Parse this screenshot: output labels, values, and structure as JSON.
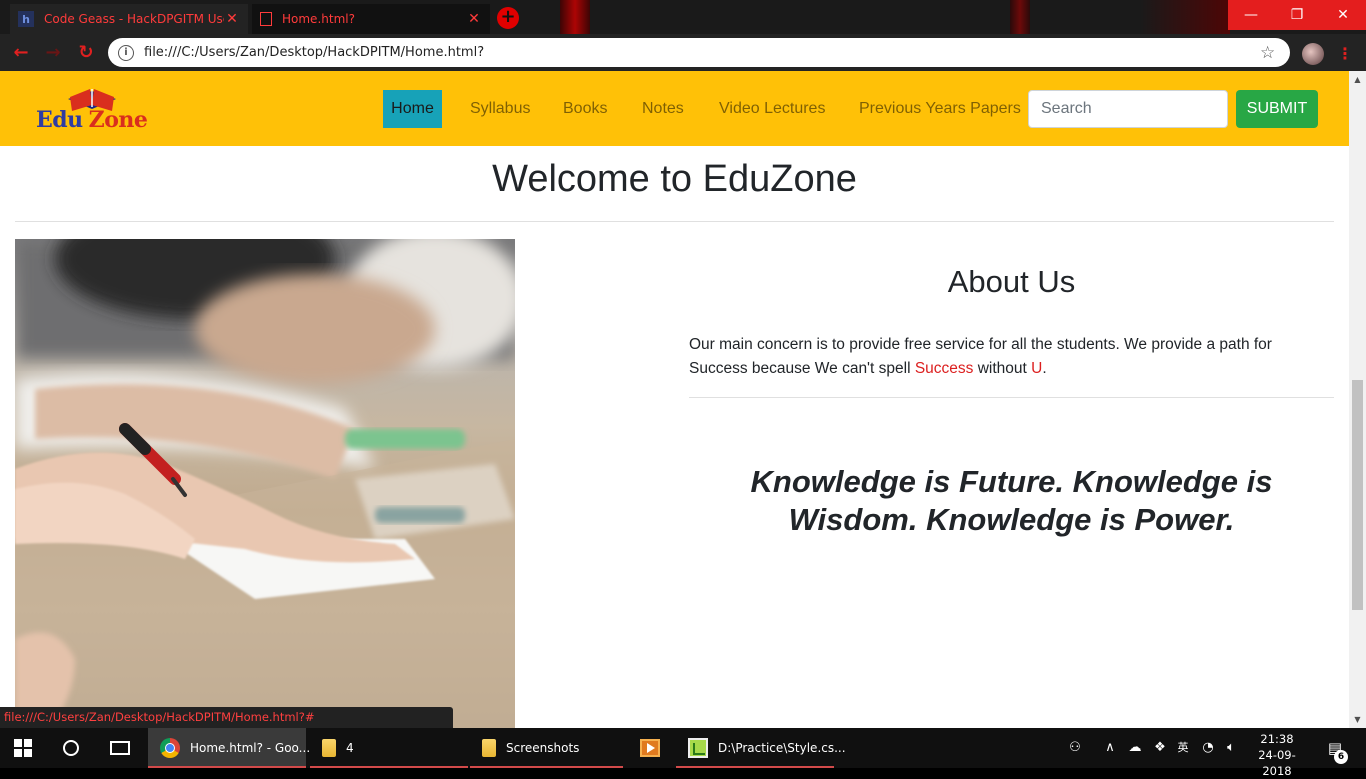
{
  "browser": {
    "tabs": [
      {
        "title": "Code Geass - HackDPGITM Users",
        "favicon": "h"
      },
      {
        "title": "Home.html?"
      }
    ],
    "new_tab_icon": "plus-icon",
    "url": "file:///C:/Users/Zan/Desktop/HackDPITM/Home.html?",
    "status_url": "file:///C:/Users/Zan/Desktop/HackDPITM/Home.html?#",
    "accent_color": "#e41e1e"
  },
  "site": {
    "logo": {
      "part1": "Edu",
      "part2": "Zone"
    },
    "nav": {
      "home": "Home",
      "syllabus": "Syllabus",
      "books": "Books",
      "notes": "Notes",
      "video": "Video Lectures",
      "papers": "Previous Years Papers"
    },
    "search": {
      "placeholder": "Search",
      "value": "",
      "button": "SUBMIT"
    },
    "colors": {
      "navbar": "#ffc107",
      "active_nav": "#17a2b8",
      "submit": "#28a745",
      "highlight": "#dc1f1f"
    }
  },
  "main": {
    "welcome": "Welcome to EduZone",
    "about": {
      "title": "About Us",
      "text_before": "Our main concern is to provide free service for all the students. We provide a path for Success because We can't spell ",
      "highlight1": "Success",
      "text_middle": " without ",
      "highlight2": "U",
      "text_end": "."
    },
    "quote": "Knowledge is Future. Knowledge is Wisdom. Knowledge is Power."
  },
  "taskbar": {
    "items": [
      {
        "label": "Home.html? - Goo...",
        "icon": "chrome-icon"
      },
      {
        "label": "4",
        "icon": "folder-icon"
      },
      {
        "label": "Screenshots",
        "icon": "folder-icon"
      },
      {
        "label": "",
        "icon": "media-player-icon"
      },
      {
        "label": "D:\\Practice\\Style.cs...",
        "icon": "notepad-icon"
      }
    ],
    "ime": "英",
    "time": "21:38",
    "date": "24-09-2018",
    "notifications": "6"
  }
}
